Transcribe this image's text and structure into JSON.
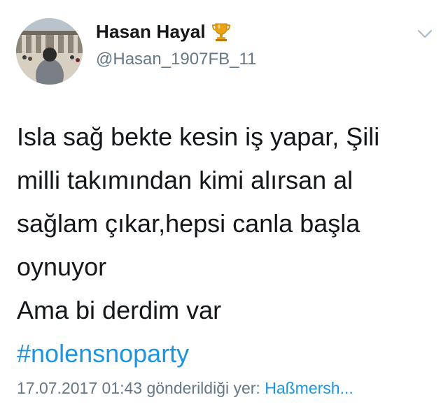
{
  "user": {
    "display_name": "Hasan Hayal",
    "handle": "@Hasan_1907FB_11",
    "badge_icon": "trophy-icon"
  },
  "menu_icon": "chevron-down-icon",
  "tweet": {
    "lines": [
      "Isla sağ bekte kesin iş yapar, Şili",
      "milli takımından kimi alırsan al",
      "sağlam çıkar,hepsi canla başla",
      "oynuyor",
      "Ama bi derdim var"
    ],
    "hashtag": "#nolensnoparty"
  },
  "meta": {
    "timestamp": "17.07.2017 01:43",
    "sent_from_label": "gönderildiği yer:",
    "place": "Haßmersh..."
  },
  "colors": {
    "link": "#1b95e0",
    "secondary_text": "#657786",
    "primary_text": "#14171a"
  }
}
